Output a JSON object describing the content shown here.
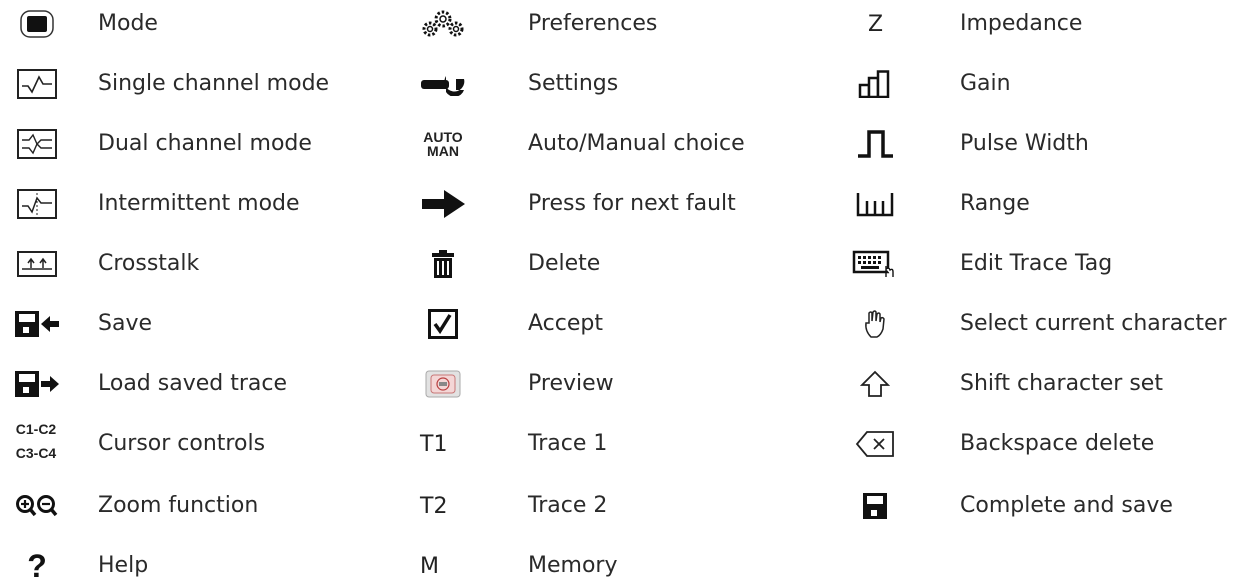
{
  "col1": [
    {
      "icon": "mode-icon",
      "label": "Mode"
    },
    {
      "icon": "single-channel-icon",
      "label": "Single channel mode"
    },
    {
      "icon": "dual-channel-icon",
      "label": "Dual channel mode"
    },
    {
      "icon": "intermittent-icon",
      "label": "Intermittent mode"
    },
    {
      "icon": "crosstalk-icon",
      "label": "Crosstalk"
    },
    {
      "icon": "save-icon",
      "label": "Save"
    },
    {
      "icon": "load-trace-icon",
      "label": "Load saved trace"
    },
    {
      "icon": "cursor-controls-icon",
      "label": "Cursor controls",
      "icon_text_top": "C1-C2",
      "icon_text_bottom": "C3-C4"
    },
    {
      "icon": "zoom-icon",
      "label": "Zoom function"
    },
    {
      "icon": "help-icon",
      "label": "Help",
      "icon_text": "?"
    }
  ],
  "col2": [
    {
      "icon": "gears-icon",
      "label": "Preferences"
    },
    {
      "icon": "wrench-icon",
      "label": "Settings"
    },
    {
      "icon": "auto-man-icon",
      "label": "Auto/Manual choice",
      "icon_text_top": "AUTO",
      "icon_text_bottom": "MAN"
    },
    {
      "icon": "arrow-right-icon",
      "label": "Press for next fault"
    },
    {
      "icon": "trash-icon",
      "label": "Delete"
    },
    {
      "icon": "checkbox-icon",
      "label": "Accept"
    },
    {
      "icon": "preview-icon",
      "label": "Preview"
    },
    {
      "icon": "t1-icon",
      "label": "Trace 1",
      "icon_text": "T1"
    },
    {
      "icon": "t2-icon",
      "label": "Trace 2",
      "icon_text": "T2"
    },
    {
      "icon": "memory-icon",
      "label": "Memory",
      "icon_text": "M"
    }
  ],
  "col3": [
    {
      "icon": "impedance-icon",
      "label": "Impedance",
      "icon_text": "Z"
    },
    {
      "icon": "gain-icon",
      "label": "Gain"
    },
    {
      "icon": "pulse-width-icon",
      "label": "Pulse Width"
    },
    {
      "icon": "range-icon",
      "label": "Range"
    },
    {
      "icon": "keyboard-icon",
      "label": "Edit Trace Tag"
    },
    {
      "icon": "hand-icon",
      "label": "Select current character"
    },
    {
      "icon": "shift-icon",
      "label": "Shift character set"
    },
    {
      "icon": "backspace-icon",
      "label": "Backspace delete"
    },
    {
      "icon": "floppy-icon",
      "label": "Complete and save"
    }
  ]
}
